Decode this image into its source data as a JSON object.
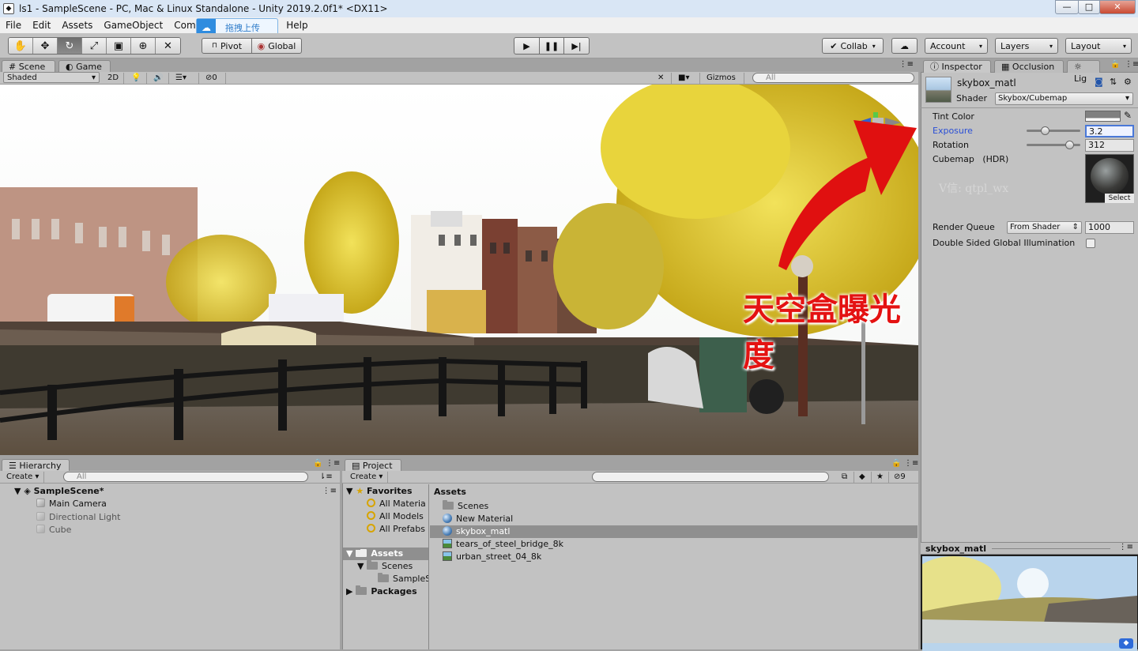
{
  "window": {
    "title": "ls1 - SampleScene - PC, Mac & Linux Standalone - Unity 2019.2.0f1* <DX11>",
    "minimize": "—",
    "maximize": "□",
    "close": "✕"
  },
  "menu": [
    "File",
    "Edit",
    "Assets",
    "GameObject",
    "Comp",
    "Help"
  ],
  "upload_badge": "拖拽上传",
  "toolbar": {
    "pivot": "Pivot",
    "global": "Global",
    "collab": "Collab",
    "account": "Account",
    "layers": "Layers",
    "layout": "Layout"
  },
  "scene_tabs": {
    "scene": "Scene",
    "game": "Game"
  },
  "scene_bar": {
    "shaded": "Shaded",
    "mode_2d": "2D",
    "hidden_count": "0",
    "gizmos": "Gizmos",
    "search_placeholder": "All"
  },
  "scene_overlay": {
    "annotation": "天空盒曝光度",
    "watermark": "V信: qtpl_wx"
  },
  "inspector_tabs": {
    "inspector": "Inspector",
    "occlusion": "Occlusion",
    "lighting": "Lig"
  },
  "material": {
    "name": "skybox_matl",
    "shader_label": "Shader",
    "shader_value": "Skybox/Cubemap"
  },
  "properties": {
    "tint_label": "Tint Color",
    "exposure_label": "Exposure",
    "exposure_value": "3.2",
    "exposure_fraction": 0.32,
    "rotation_label": "Rotation",
    "rotation_value": "312",
    "rotation_fraction": 0.867,
    "cubemap_label": "Cubemap",
    "cubemap_hdr": "(HDR)",
    "cubemap_select": "Select",
    "render_queue_label": "Render Queue",
    "render_queue_mode": "From Shader",
    "render_queue_value": "1000",
    "double_sided_label": "Double Sided Global Illumination"
  },
  "preview": {
    "title": "skybox_matl"
  },
  "hierarchy": {
    "tab": "Hierarchy",
    "create": "Create",
    "search_placeholder": "All",
    "scene": "SampleScene*",
    "items": [
      "Main Camera",
      "Directional Light",
      "Cube"
    ]
  },
  "project": {
    "tab": "Project",
    "create": "Create",
    "hidden_count": "9",
    "favorites_label": "Favorites",
    "favorites": [
      "All Materia",
      "All Models",
      "All Prefabs"
    ],
    "tree_assets": "Assets",
    "tree_scenes": "Scenes",
    "tree_sample": "SampleS",
    "tree_packages": "Packages",
    "assets_header": "Assets",
    "assets": [
      {
        "name": "Scenes",
        "icon": "folder-icon"
      },
      {
        "name": "New Material",
        "icon": "material-icon"
      },
      {
        "name": "skybox_matl",
        "icon": "material-icon"
      },
      {
        "name": "tears_of_steel_bridge_8k",
        "icon": "texture-icon"
      },
      {
        "name": "urban_street_04_8k",
        "icon": "texture-icon"
      }
    ]
  }
}
